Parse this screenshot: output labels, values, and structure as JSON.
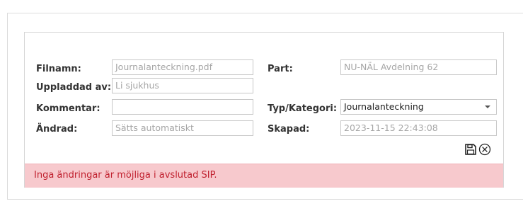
{
  "form": {
    "filename_label": "Filnamn:",
    "filename_value": "Journalanteckning.pdf",
    "uploaded_by_label": "Uppladdad av:",
    "uploaded_by_value": "Li sjukhus",
    "comment_label": "Kommentar:",
    "comment_value": "",
    "changed_label": "Ändrad:",
    "changed_placeholder": "Sätts automatiskt",
    "part_label": "Part:",
    "part_value": "NU-NÄL Avdelning 62",
    "type_label": "Typ/Kategori:",
    "type_value": "Journalanteckning",
    "created_label": "Skapad:",
    "created_value": "2023-11-15 22:43:08"
  },
  "actions": {
    "save_icon": "floppy-disk-icon",
    "cancel_icon": "circled-x-icon"
  },
  "banner": {
    "message": "Inga ändringar är möjliga i avslutad SIP.",
    "background": "#f7c9cd",
    "color": "#c0202e"
  }
}
